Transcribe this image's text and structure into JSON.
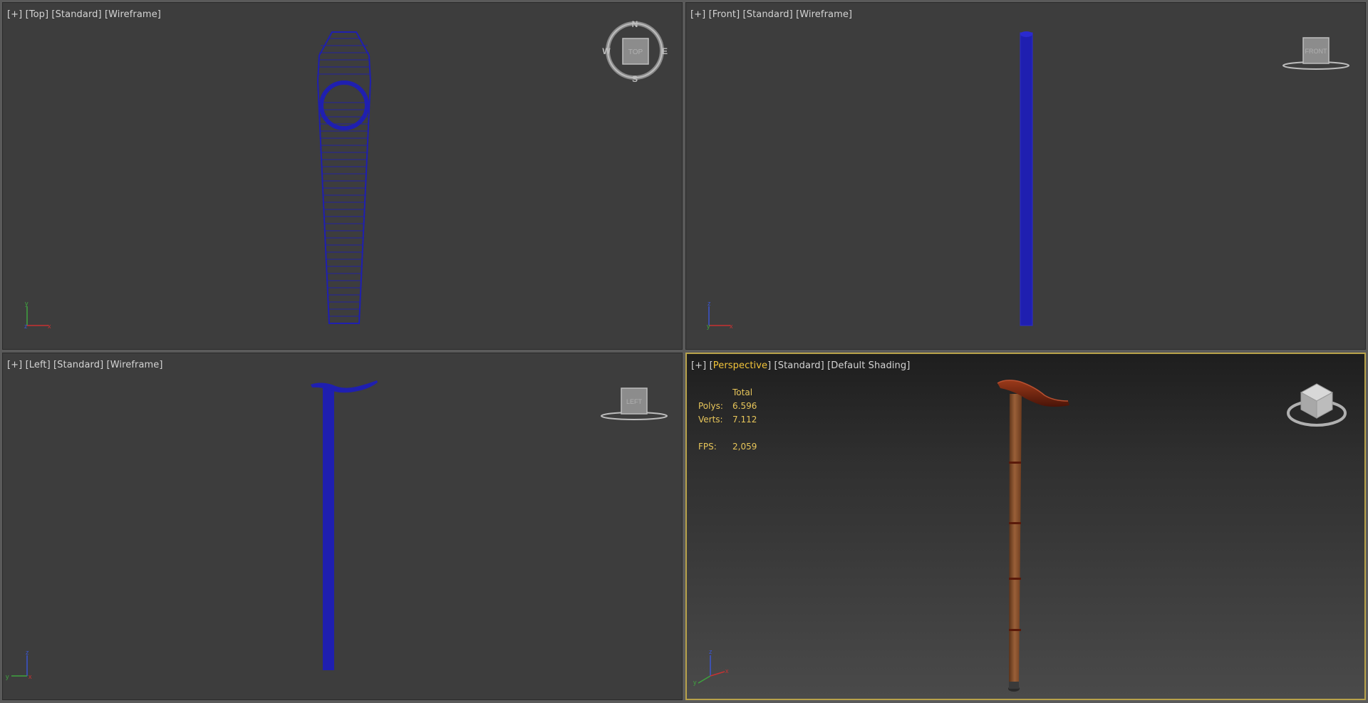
{
  "viewports": {
    "top": {
      "plus": "[+]",
      "view": "[Top]",
      "mode": "[Standard]",
      "shading": "[Wireframe]",
      "compass": {
        "n": "N",
        "s": "S",
        "e": "E",
        "w": "W"
      },
      "cube_label": "TOP",
      "axes": {
        "a": "y",
        "b": "z",
        "c": "x"
      }
    },
    "front": {
      "plus": "[+]",
      "view": "[Front]",
      "mode": "[Standard]",
      "shading": "[Wireframe]",
      "cube_label": "FRONT",
      "axes": {
        "a": "z",
        "b": "y",
        "c": "x"
      }
    },
    "left": {
      "plus": "[+]",
      "view": "[Left]",
      "mode": "[Standard]",
      "shading": "[Wireframe]",
      "cube_label": "LEFT",
      "axes": {
        "a": "z",
        "b": "y",
        "c": "x"
      }
    },
    "perspective": {
      "plus": "[+]",
      "view": "Perspective",
      "mode": "[Standard]",
      "shading": "[Default Shading]",
      "axes": {
        "a": "z",
        "b": "y",
        "c": "x"
      },
      "stats": {
        "header": "Total",
        "polys_label": "Polys:",
        "polys_value": "6.596",
        "verts_label": "Verts:",
        "verts_value": "7.112",
        "fps_label": "FPS:",
        "fps_value": "2,059"
      }
    }
  },
  "colors": {
    "wire": "#1f1fb0",
    "active_viewport": "#b8a24a",
    "stats_text": "#e8c65a",
    "wood": "#8a5230",
    "handle": "#7a2612"
  }
}
